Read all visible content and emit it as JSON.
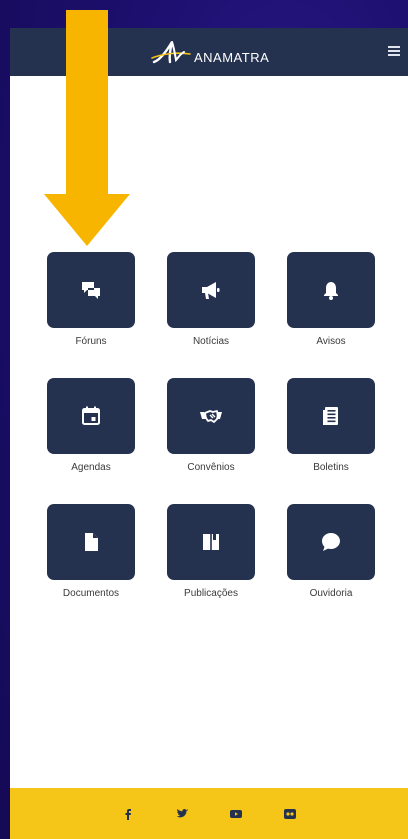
{
  "header": {
    "brand": "ANAMATRA",
    "logo_icon": "anamatra-logo",
    "menu_icon": "hamburger-menu-icon"
  },
  "menu": [
    {
      "label": "Fóruns",
      "icon": "chat-bubbles-icon"
    },
    {
      "label": "Notícias",
      "icon": "megaphone-icon"
    },
    {
      "label": "Avisos",
      "icon": "bell-icon"
    },
    {
      "label": "Agendas",
      "icon": "calendar-icon"
    },
    {
      "label": "Convênios",
      "icon": "handshake-icon"
    },
    {
      "label": "Boletins",
      "icon": "newspaper-icon"
    },
    {
      "label": "Documentos",
      "icon": "document-icon"
    },
    {
      "label": "Publicações",
      "icon": "book-icon"
    },
    {
      "label": "Ouvidoria",
      "icon": "speech-bubble-icon"
    }
  ],
  "footer": {
    "social": [
      "facebook-icon",
      "twitter-icon",
      "youtube-icon",
      "flickr-icon"
    ]
  },
  "annotation": {
    "arrow_icon": "down-arrow-icon"
  },
  "colors": {
    "header_bg": "#243250",
    "tile_bg": "#243250",
    "footer_bg": "#f5c518",
    "arrow": "#f7b500",
    "background": "#1c0f6e"
  }
}
